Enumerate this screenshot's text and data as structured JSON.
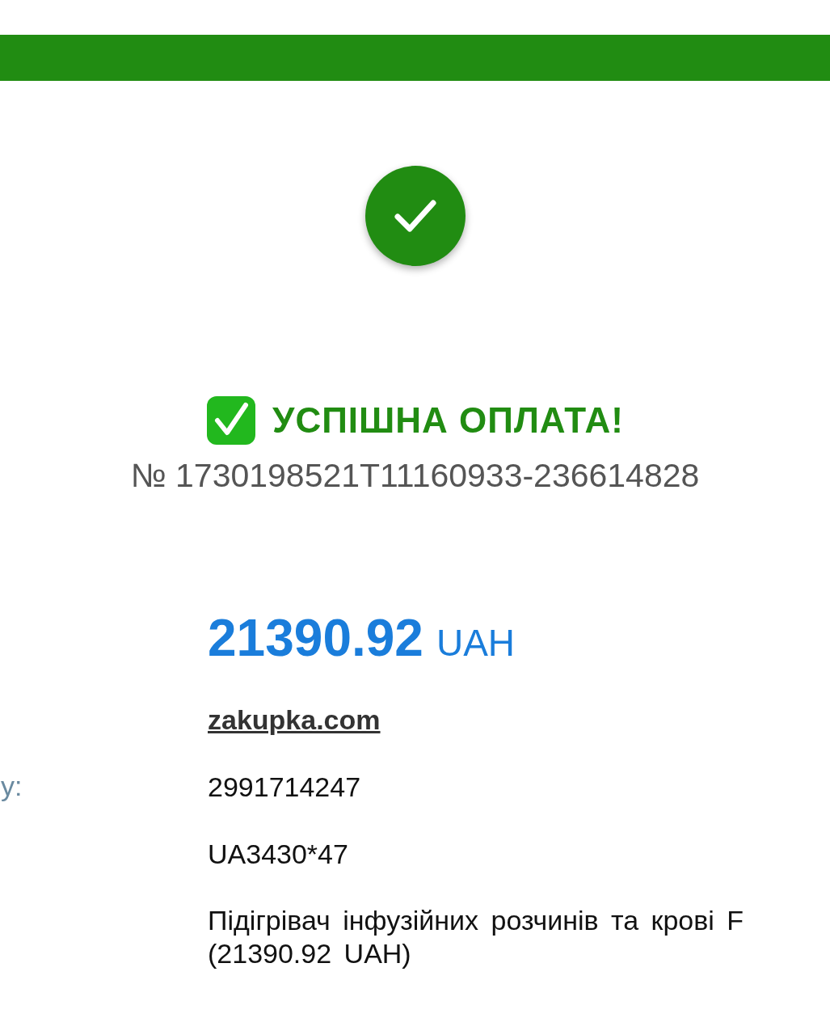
{
  "title": "УСПІШНА ОПЛАТА!",
  "payment_number": "№ 1730198521T11160933-236614828",
  "amount": {
    "value": "21390.92",
    "currency": "UAH"
  },
  "details": [
    {
      "kind": "link",
      "value": "zakupka.com"
    },
    {
      "kind": "text",
      "label": "у:",
      "value": "2991714247"
    },
    {
      "kind": "text",
      "value": "UA3430*47"
    },
    {
      "kind": "text",
      "value": "Підігрівач інфузійних розчинів та крові F\n(21390.92 UAH)"
    }
  ]
}
